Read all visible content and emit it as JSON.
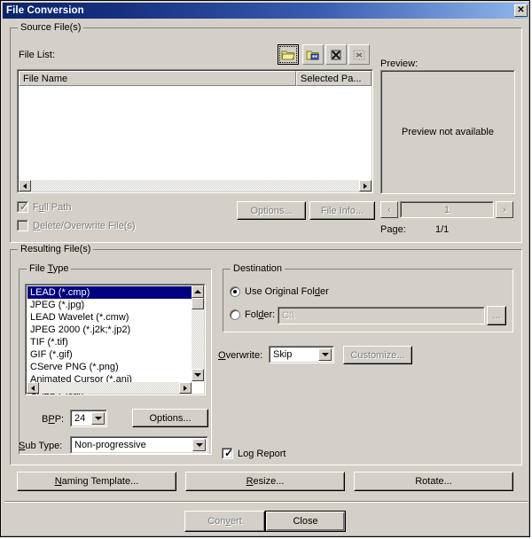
{
  "window": {
    "title": "File Conversion",
    "close_label": "✕"
  },
  "source_group": {
    "legend": "Source File(s)",
    "file_list_label": "File List:",
    "toolbar": [
      {
        "name": "open-folder-button",
        "state": "pressed"
      },
      {
        "name": "add-files-button",
        "state": "raised"
      },
      {
        "name": "delete-file-button",
        "state": "raised"
      },
      {
        "name": "clear-list-button",
        "state": "raised"
      }
    ],
    "columns": [
      "File Name",
      "Selected Pa..."
    ],
    "rows": [],
    "full_path_label": "Full Path",
    "full_path_checked": true,
    "full_path_enabled": false,
    "delete_overwrite_label": "Delete/Overwrite File(s)",
    "delete_overwrite_checked": false,
    "delete_overwrite_enabled": false,
    "options_button": "Options...",
    "file_info_button": "File Info..."
  },
  "preview": {
    "label": "Preview:",
    "empty_text": "Preview not available",
    "prev_label": "‹",
    "next_label": "›",
    "page_value": "1",
    "page_label": "Page:",
    "page_count": "1/1"
  },
  "resulting_group": {
    "legend": "Resulting File(s)",
    "file_type": {
      "legend": "File Type",
      "items": [
        "LEAD (*.cmp)",
        "JPEG (*.jpg)",
        "LEAD Wavelet (*.cmw)",
        "JPEG 2000 (*.j2k;*.jp2)",
        "TIF (*.tif)",
        "GIF (*.gif)",
        "CServe PNG (*.png)",
        "Animated Cursor (*.ani)",
        "CALS (*.cal)"
      ],
      "selected_index": 0,
      "bpp_label": "BPP:",
      "bpp_value": "24",
      "options_button": "Options...",
      "sub_type_label": "Sub Type:",
      "sub_type_value": "Non-progressive"
    },
    "destination": {
      "legend": "Destination",
      "use_original_label": "Use Original Folder",
      "use_original_selected": true,
      "folder_label": "Folder:",
      "folder_selected": false,
      "folder_value": "C:\\",
      "browse_button": "...",
      "overwrite_label": "Overwrite:",
      "overwrite_value": "Skip",
      "customize_button": "Customize..."
    },
    "log_report_label": "Log Report",
    "log_report_checked": true,
    "naming_template_button": "Naming Template...",
    "resize_button": "Resize...",
    "rotate_button": "Rotate..."
  },
  "footer": {
    "convert_button": "Convert",
    "convert_enabled": false,
    "close_button": "Close",
    "close_enabled": true
  },
  "colors": {
    "face": "#d4d0c8",
    "title_start": "#0a246a",
    "title_end": "#a6c8f0",
    "highlight": "#000080",
    "disabled_text": "#808080"
  }
}
